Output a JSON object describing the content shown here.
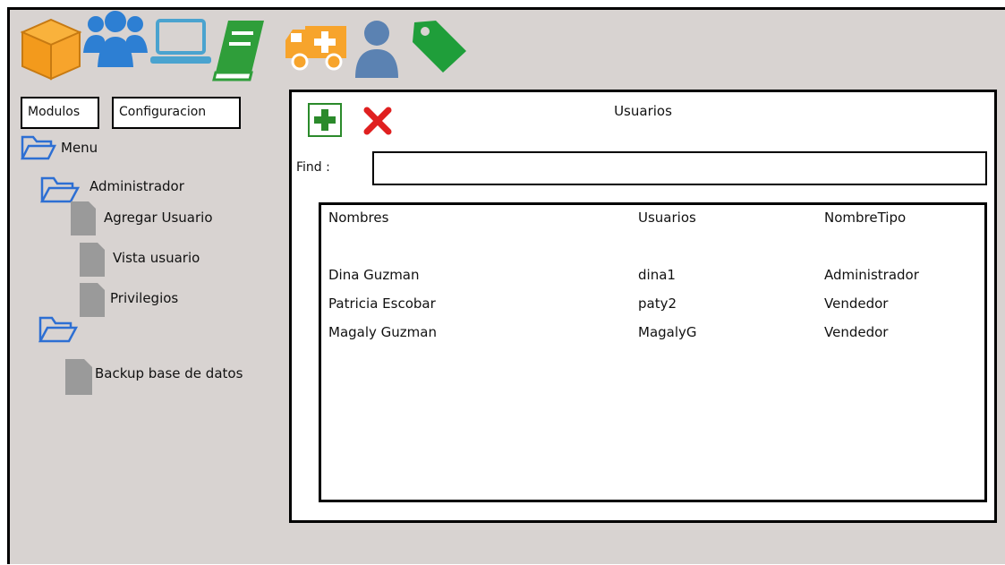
{
  "toolbar": {
    "icons": [
      "box-icon",
      "users-icon",
      "laptop-icon",
      "book-icon",
      "ambulance-icon",
      "user-icon",
      "tag-icon"
    ]
  },
  "tabs": {
    "modulos": "Modulos",
    "configuracion": "Configuracion"
  },
  "tree": {
    "menu": "Menu",
    "administrador": "Administrador",
    "agregar_usuario": "Agregar Usuario",
    "vista_usuario": "Vista usuario",
    "privilegios": "Privilegios",
    "backup": "Backup base de datos"
  },
  "panel": {
    "title": "Usuarios",
    "find_label": "Find :",
    "find_value": "",
    "columns": [
      "Nombres",
      "Usuarios",
      "NombreTipo"
    ],
    "rows": [
      [
        "Dina Guzman",
        "dina1",
        "Administrador"
      ],
      [
        "Patricia Escobar",
        "paty2",
        "Vendedor"
      ],
      [
        "Magaly Guzman",
        "MagalyG",
        "Vendedor"
      ]
    ]
  },
  "colors": {
    "background": "#d8d3d1",
    "box": "#f7a42c",
    "users": "#2d7fd3",
    "laptop": "#4aa3cf",
    "book": "#2f9e3a",
    "ambulance": "#f7a42c",
    "user": "#5b82b2",
    "tag": "#1f9e3a",
    "add": "#2b8a2b",
    "delete": "#e02020"
  }
}
